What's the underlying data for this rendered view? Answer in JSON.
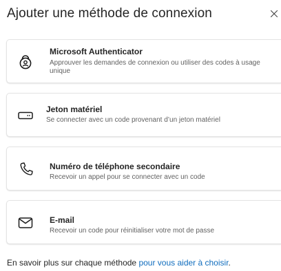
{
  "dialog": {
    "title": "Ajouter une méthode de connexion",
    "close_icon": "close-icon"
  },
  "options": [
    {
      "name": "Microsoft Authenticator",
      "description": "Approuver les demandes de connexion ou utiliser des codes à usage unique",
      "icon": "authenticator-lock-icon"
    },
    {
      "name": "Jeton matériel",
      "description": "Se connecter avec un code provenant d’un jeton matériel",
      "icon": "hardware-token-icon"
    },
    {
      "name": "Numéro de téléphone secondaire",
      "description": "Recevoir un appel pour se connecter avec un code",
      "icon": "phone-icon"
    },
    {
      "name": "E-mail",
      "description": "Recevoir un code pour réinitialiser votre mot de passe",
      "icon": "mail-icon"
    }
  ],
  "footer": {
    "text": "En savoir plus sur chaque méthode ",
    "link": "pour vous aider à choisir",
    "suffix": "."
  },
  "colors": {
    "link": "#0f6cbd",
    "text": "#242424",
    "secondary_text": "#616161",
    "border": "#e3e3e3"
  }
}
